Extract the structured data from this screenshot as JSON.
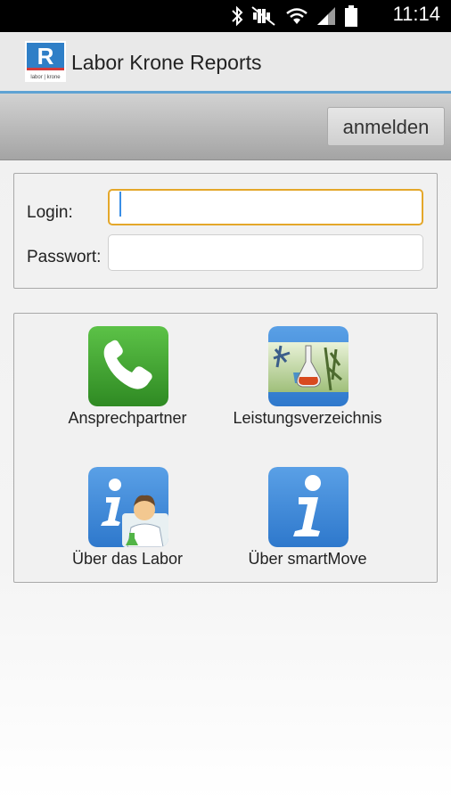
{
  "status_bar": {
    "time": "11:14",
    "icons": [
      "bluetooth-icon",
      "mute-icon",
      "wifi-icon",
      "signal-icon",
      "battery-icon"
    ]
  },
  "app": {
    "title": "Labor Krone Reports",
    "logo": {
      "letter": "R",
      "tagline": "labor | krone"
    }
  },
  "toolbar": {
    "login_button": "anmelden"
  },
  "login_form": {
    "login_label": "Login:",
    "login_value": "",
    "password_label": "Passwort:",
    "password_value": ""
  },
  "menu": {
    "items": [
      {
        "label": "Ansprechpartner",
        "icon": "phone-icon"
      },
      {
        "label": "Leistungsverzeichnis",
        "icon": "lab-flask-icon"
      },
      {
        "label": "Über das Labor",
        "icon": "info-lab-icon"
      },
      {
        "label": "Über smartMove",
        "icon": "info-icon"
      }
    ]
  },
  "colors": {
    "accent_line": "#5fa3d3",
    "focus_border": "#e4a72a",
    "phone_green": "#3f9b2f",
    "info_blue": "#3f8ee0"
  }
}
